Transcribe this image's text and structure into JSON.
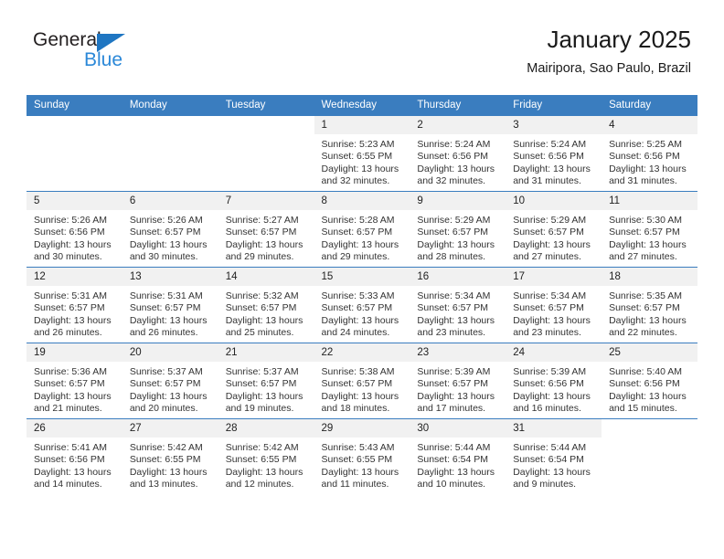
{
  "brand": {
    "name_part1": "General",
    "name_part2": "Blue",
    "triangle_icon": "triangle-icon",
    "accent_color": "#2b88d8"
  },
  "header": {
    "title": "January 2025",
    "subtitle": "Mairipora, Sao Paulo, Brazil"
  },
  "calendar": {
    "header_bg": "#3a7dbf",
    "daynum_bg": "#f1f1f1",
    "weekdays": [
      "Sunday",
      "Monday",
      "Tuesday",
      "Wednesday",
      "Thursday",
      "Friday",
      "Saturday"
    ],
    "weeks": [
      [
        {
          "day": "",
          "sunrise": "",
          "sunset": "",
          "daylight": "",
          "empty": true
        },
        {
          "day": "",
          "sunrise": "",
          "sunset": "",
          "daylight": "",
          "empty": true
        },
        {
          "day": "",
          "sunrise": "",
          "sunset": "",
          "daylight": "",
          "empty": true
        },
        {
          "day": "1",
          "sunrise": "Sunrise: 5:23 AM",
          "sunset": "Sunset: 6:55 PM",
          "daylight": "Daylight: 13 hours and 32 minutes.",
          "empty": false
        },
        {
          "day": "2",
          "sunrise": "Sunrise: 5:24 AM",
          "sunset": "Sunset: 6:56 PM",
          "daylight": "Daylight: 13 hours and 32 minutes.",
          "empty": false
        },
        {
          "day": "3",
          "sunrise": "Sunrise: 5:24 AM",
          "sunset": "Sunset: 6:56 PM",
          "daylight": "Daylight: 13 hours and 31 minutes.",
          "empty": false
        },
        {
          "day": "4",
          "sunrise": "Sunrise: 5:25 AM",
          "sunset": "Sunset: 6:56 PM",
          "daylight": "Daylight: 13 hours and 31 minutes.",
          "empty": false
        }
      ],
      [
        {
          "day": "5",
          "sunrise": "Sunrise: 5:26 AM",
          "sunset": "Sunset: 6:56 PM",
          "daylight": "Daylight: 13 hours and 30 minutes.",
          "empty": false
        },
        {
          "day": "6",
          "sunrise": "Sunrise: 5:26 AM",
          "sunset": "Sunset: 6:57 PM",
          "daylight": "Daylight: 13 hours and 30 minutes.",
          "empty": false
        },
        {
          "day": "7",
          "sunrise": "Sunrise: 5:27 AM",
          "sunset": "Sunset: 6:57 PM",
          "daylight": "Daylight: 13 hours and 29 minutes.",
          "empty": false
        },
        {
          "day": "8",
          "sunrise": "Sunrise: 5:28 AM",
          "sunset": "Sunset: 6:57 PM",
          "daylight": "Daylight: 13 hours and 29 minutes.",
          "empty": false
        },
        {
          "day": "9",
          "sunrise": "Sunrise: 5:29 AM",
          "sunset": "Sunset: 6:57 PM",
          "daylight": "Daylight: 13 hours and 28 minutes.",
          "empty": false
        },
        {
          "day": "10",
          "sunrise": "Sunrise: 5:29 AM",
          "sunset": "Sunset: 6:57 PM",
          "daylight": "Daylight: 13 hours and 27 minutes.",
          "empty": false
        },
        {
          "day": "11",
          "sunrise": "Sunrise: 5:30 AM",
          "sunset": "Sunset: 6:57 PM",
          "daylight": "Daylight: 13 hours and 27 minutes.",
          "empty": false
        }
      ],
      [
        {
          "day": "12",
          "sunrise": "Sunrise: 5:31 AM",
          "sunset": "Sunset: 6:57 PM",
          "daylight": "Daylight: 13 hours and 26 minutes.",
          "empty": false
        },
        {
          "day": "13",
          "sunrise": "Sunrise: 5:31 AM",
          "sunset": "Sunset: 6:57 PM",
          "daylight": "Daylight: 13 hours and 26 minutes.",
          "empty": false
        },
        {
          "day": "14",
          "sunrise": "Sunrise: 5:32 AM",
          "sunset": "Sunset: 6:57 PM",
          "daylight": "Daylight: 13 hours and 25 minutes.",
          "empty": false
        },
        {
          "day": "15",
          "sunrise": "Sunrise: 5:33 AM",
          "sunset": "Sunset: 6:57 PM",
          "daylight": "Daylight: 13 hours and 24 minutes.",
          "empty": false
        },
        {
          "day": "16",
          "sunrise": "Sunrise: 5:34 AM",
          "sunset": "Sunset: 6:57 PM",
          "daylight": "Daylight: 13 hours and 23 minutes.",
          "empty": false
        },
        {
          "day": "17",
          "sunrise": "Sunrise: 5:34 AM",
          "sunset": "Sunset: 6:57 PM",
          "daylight": "Daylight: 13 hours and 23 minutes.",
          "empty": false
        },
        {
          "day": "18",
          "sunrise": "Sunrise: 5:35 AM",
          "sunset": "Sunset: 6:57 PM",
          "daylight": "Daylight: 13 hours and 22 minutes.",
          "empty": false
        }
      ],
      [
        {
          "day": "19",
          "sunrise": "Sunrise: 5:36 AM",
          "sunset": "Sunset: 6:57 PM",
          "daylight": "Daylight: 13 hours and 21 minutes.",
          "empty": false
        },
        {
          "day": "20",
          "sunrise": "Sunrise: 5:37 AM",
          "sunset": "Sunset: 6:57 PM",
          "daylight": "Daylight: 13 hours and 20 minutes.",
          "empty": false
        },
        {
          "day": "21",
          "sunrise": "Sunrise: 5:37 AM",
          "sunset": "Sunset: 6:57 PM",
          "daylight": "Daylight: 13 hours and 19 minutes.",
          "empty": false
        },
        {
          "day": "22",
          "sunrise": "Sunrise: 5:38 AM",
          "sunset": "Sunset: 6:57 PM",
          "daylight": "Daylight: 13 hours and 18 minutes.",
          "empty": false
        },
        {
          "day": "23",
          "sunrise": "Sunrise: 5:39 AM",
          "sunset": "Sunset: 6:57 PM",
          "daylight": "Daylight: 13 hours and 17 minutes.",
          "empty": false
        },
        {
          "day": "24",
          "sunrise": "Sunrise: 5:39 AM",
          "sunset": "Sunset: 6:56 PM",
          "daylight": "Daylight: 13 hours and 16 minutes.",
          "empty": false
        },
        {
          "day": "25",
          "sunrise": "Sunrise: 5:40 AM",
          "sunset": "Sunset: 6:56 PM",
          "daylight": "Daylight: 13 hours and 15 minutes.",
          "empty": false
        }
      ],
      [
        {
          "day": "26",
          "sunrise": "Sunrise: 5:41 AM",
          "sunset": "Sunset: 6:56 PM",
          "daylight": "Daylight: 13 hours and 14 minutes.",
          "empty": false
        },
        {
          "day": "27",
          "sunrise": "Sunrise: 5:42 AM",
          "sunset": "Sunset: 6:55 PM",
          "daylight": "Daylight: 13 hours and 13 minutes.",
          "empty": false
        },
        {
          "day": "28",
          "sunrise": "Sunrise: 5:42 AM",
          "sunset": "Sunset: 6:55 PM",
          "daylight": "Daylight: 13 hours and 12 minutes.",
          "empty": false
        },
        {
          "day": "29",
          "sunrise": "Sunrise: 5:43 AM",
          "sunset": "Sunset: 6:55 PM",
          "daylight": "Daylight: 13 hours and 11 minutes.",
          "empty": false
        },
        {
          "day": "30",
          "sunrise": "Sunrise: 5:44 AM",
          "sunset": "Sunset: 6:54 PM",
          "daylight": "Daylight: 13 hours and 10 minutes.",
          "empty": false
        },
        {
          "day": "31",
          "sunrise": "Sunrise: 5:44 AM",
          "sunset": "Sunset: 6:54 PM",
          "daylight": "Daylight: 13 hours and 9 minutes.",
          "empty": false
        },
        {
          "day": "",
          "sunrise": "",
          "sunset": "",
          "daylight": "",
          "empty": true
        }
      ]
    ]
  }
}
